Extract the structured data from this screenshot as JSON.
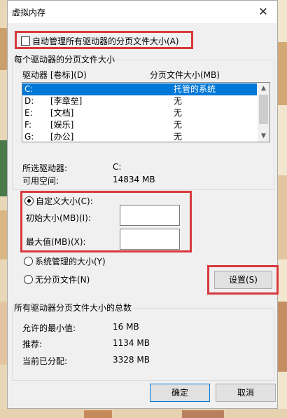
{
  "window": {
    "title": "虚拟内存",
    "close_glyph": "✕"
  },
  "auto_manage": {
    "label": "自动管理所有驱动器的分页文件大小(A)",
    "checked": false
  },
  "drives_group": {
    "title": "每个驱动器的分页文件大小",
    "col_drive": "驱动器 [卷标](D)",
    "col_size": "分页文件大小(MB)",
    "rows": [
      {
        "drive": "C:",
        "label": "",
        "size": "托管的系统",
        "selected": true
      },
      {
        "drive": "D:",
        "label": "[李章垒]",
        "size": "无",
        "selected": false
      },
      {
        "drive": "E:",
        "label": "[文档]",
        "size": "无",
        "selected": false
      },
      {
        "drive": "F:",
        "label": "[娱乐]",
        "size": "无",
        "selected": false
      },
      {
        "drive": "G:",
        "label": "[办公]",
        "size": "无",
        "selected": false
      }
    ],
    "selected_drive_label": "所选驱动器:",
    "selected_drive_value": "C:",
    "free_space_label": "可用空间:",
    "free_space_value": "14834 MB",
    "custom_size_label": "自定义大小(C):",
    "initial_size_label": "初始大小(MB)(I):",
    "initial_size_value": "",
    "max_size_label": "最大值(MB)(X):",
    "max_size_value": "",
    "system_managed_label": "系统管理的大小(Y)",
    "no_paging_label": "无分页文件(N)",
    "set_button": "设置(S)",
    "selected_option": "custom"
  },
  "totals_group": {
    "title": "所有驱动器分页文件大小的总数",
    "min_label": "允许的最小值:",
    "min_value": "16 MB",
    "recommended_label": "推荐:",
    "recommended_value": "1134 MB",
    "current_label": "当前已分配:",
    "current_value": "3328 MB"
  },
  "buttons": {
    "ok": "确定",
    "cancel": "取消"
  },
  "colors": {
    "highlight_frame": "#d8393c",
    "selection": "#0078d7",
    "dialog_bg": "#f0f0f0"
  }
}
